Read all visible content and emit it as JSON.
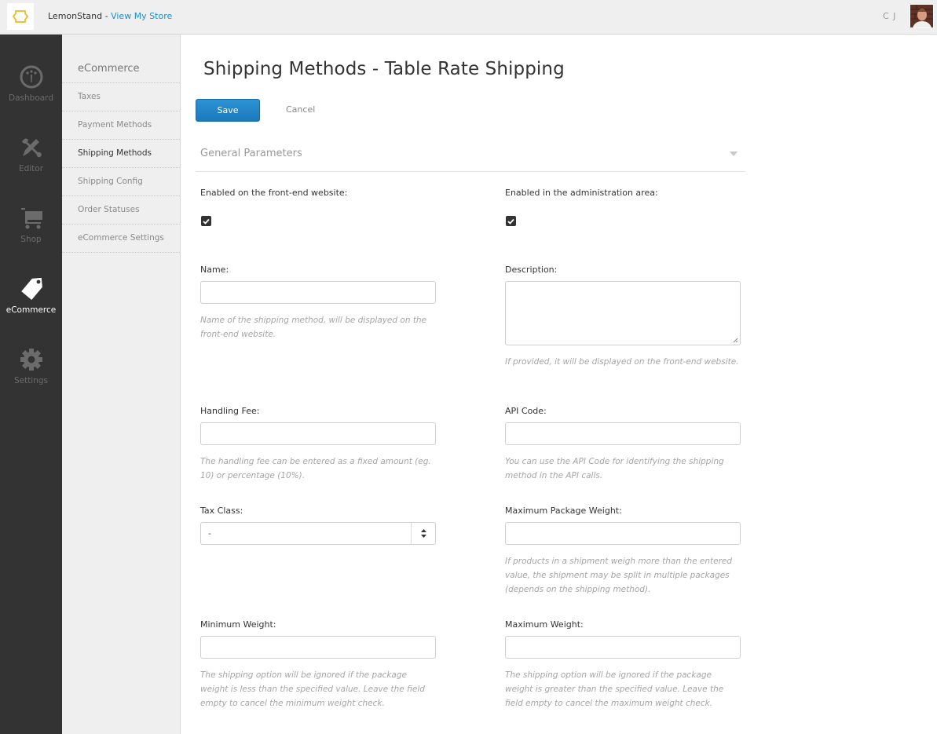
{
  "topbar": {
    "brand": "LemonStand",
    "separator": " - ",
    "store_link": "View My Store",
    "user_initials": "C J",
    "logo_color": "#f0c232",
    "link_color": "#1a8fd0"
  },
  "main_nav": [
    {
      "label": "Dashboard",
      "icon": "dashboard-gauge-icon",
      "active": false
    },
    {
      "label": "Editor",
      "icon": "editor-tools-icon",
      "active": false
    },
    {
      "label": "Shop",
      "icon": "shopping-cart-icon",
      "active": false
    },
    {
      "label": "eCommerce",
      "icon": "price-tag-icon",
      "active": true
    },
    {
      "label": "Settings",
      "icon": "gear-icon",
      "active": false
    }
  ],
  "sub_nav": {
    "title": "eCommerce",
    "items": [
      {
        "label": "Taxes",
        "active": false
      },
      {
        "label": "Payment Methods",
        "active": false
      },
      {
        "label": "Shipping Methods",
        "active": true
      },
      {
        "label": "Shipping Config",
        "active": false
      },
      {
        "label": "Order Statuses",
        "active": false
      },
      {
        "label": "eCommerce Settings",
        "active": false
      }
    ]
  },
  "page": {
    "title": "Shipping Methods - Table Rate Shipping",
    "save_label": "Save",
    "cancel_label": "Cancel",
    "accent_color": "#1f82c6"
  },
  "section": {
    "title": "General Parameters"
  },
  "form": {
    "enabled_frontend": {
      "label": "Enabled on the front-end website:",
      "checked": true
    },
    "enabled_admin": {
      "label": "Enabled in the administration area:",
      "checked": true
    },
    "name": {
      "label": "Name:",
      "value": "",
      "help": "Name of the shipping method, will be displayed on the front-end website."
    },
    "description": {
      "label": "Description:",
      "value": "",
      "help": "If provided, it will be displayed on the front-end website."
    },
    "handling_fee": {
      "label": "Handling Fee:",
      "value": "",
      "help": "The handling fee can be entered as a fixed amount (eg. 10) or percentage (10%)."
    },
    "api_code": {
      "label": "API Code:",
      "value": "",
      "help": "You can use the API Code for identifying the shipping method in the API calls."
    },
    "tax_class": {
      "label": "Tax Class:",
      "selected": "-"
    },
    "max_package_weight": {
      "label": "Maximum Package Weight:",
      "value": "",
      "help": "If products in a shipment weigh more than the entered value, the shipment may be split in multiple packages (depends on the shipping method)."
    },
    "min_weight": {
      "label": "Minimum Weight:",
      "value": "",
      "help": "The shipping option will be ignored if the package weight is less than the specified value. Leave the field empty to cancel the minimum weight check."
    },
    "max_weight": {
      "label": "Maximum Weight:",
      "value": "",
      "help": "The shipping option will be ignored if the package weight is greater than the specified value. Leave the field empty to cancel the maximum weight check."
    }
  }
}
